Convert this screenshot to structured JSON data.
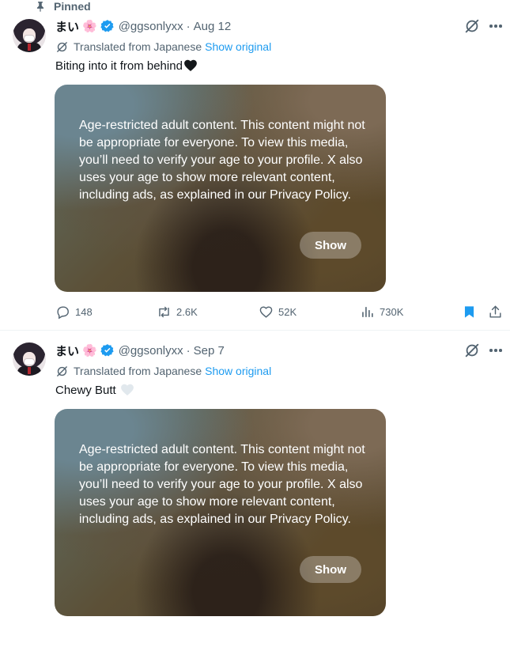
{
  "tweets": [
    {
      "pinned_label": "Pinned",
      "author_name": "まい",
      "author_emoji": "🌸",
      "handle": "@ggsonlyxx",
      "separator": "·",
      "date": "Aug 12",
      "translated_label": "Translated from Japanese",
      "show_original_label": "Show original",
      "text": "Biting into it from behind",
      "text_emoji_color": "#0f1419",
      "media_warning": "Age-restricted adult content. This content might not be appropriate for everyone. To view this media, you’ll need to verify your age to your profile. X also uses your age to show more relevant content, including ads, as explained in our Privacy Policy.",
      "media_show_label": "Show",
      "stats": {
        "replies": "148",
        "reposts": "2.6K",
        "likes": "52K",
        "views": "730K"
      },
      "bookmarked": true
    },
    {
      "author_name": "まい",
      "author_emoji": "🌸",
      "handle": "@ggsonlyxx",
      "separator": "·",
      "date": "Sep 7",
      "translated_label": "Translated from Japanese",
      "show_original_label": "Show original",
      "text": "Chewy Butt",
      "text_emoji_color": "#e1e8ed",
      "media_warning": "Age-restricted adult content. This content might not be appropriate for everyone. To view this media, you’ll need to verify your age to your profile. X also uses your age to show more relevant content, including ads, as explained in our Privacy Policy.",
      "media_show_label": "Show"
    }
  ],
  "colors": {
    "text_primary": "#0f1419",
    "text_secondary": "#536471",
    "link_blue": "#1d9bf0",
    "verified_blue": "#1d9bf0",
    "divider": "#eff3f4"
  },
  "icons": [
    "pin-icon",
    "verified-badge-icon",
    "grok-icon",
    "more-icon",
    "translate-icon",
    "heart-emoji-icon",
    "reply-icon",
    "repost-icon",
    "like-icon",
    "views-icon",
    "bookmark-icon",
    "share-icon"
  ]
}
